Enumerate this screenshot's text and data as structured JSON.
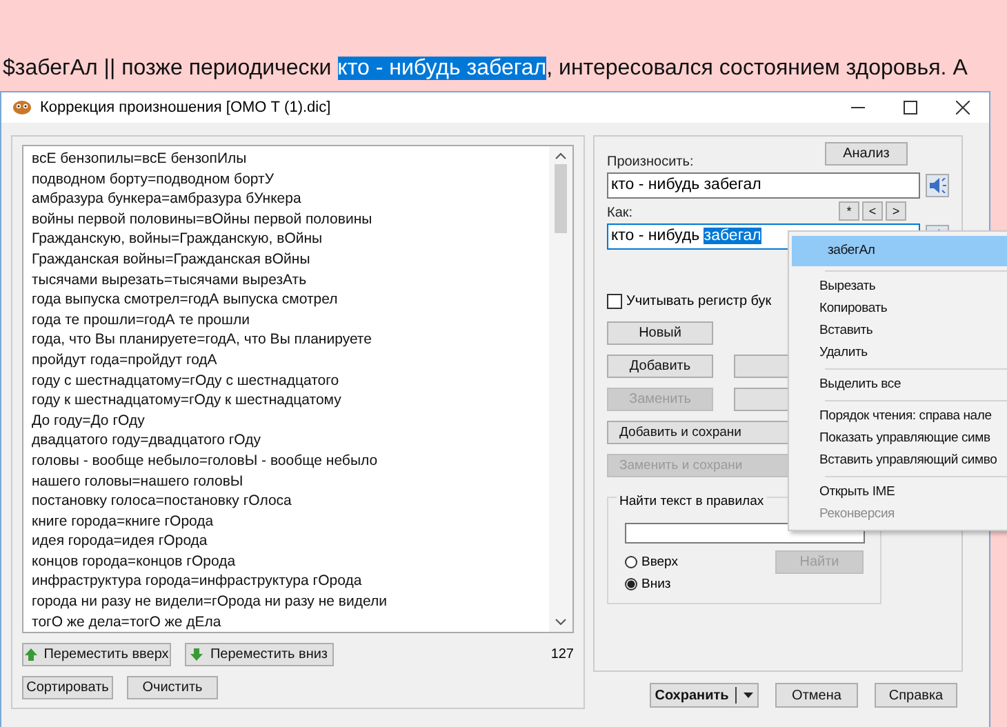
{
  "page_text": [
    {
      "text": "$забегАл || позже периодически ",
      "selected": false
    },
    {
      "text": "кто - нибудь забегал",
      "selected": true
    },
    {
      "text": ", интересовался состоянием здоровья. А",
      "selected": false
    }
  ],
  "window": {
    "title": "Коррекция произношения [ОМО Т (1).dic]"
  },
  "rules": [
    "всЕ бензопилы=всЕ бензопИлы",
    "подводном борту=подводном бортУ",
    "амбразура бункера=амбразура бУнкера",
    "войны первой половины=вОйны первой половины",
    "Гражданскую, войны=Гражданскую, вОйны",
    "Гражданская войны=Гражданская вОйны",
    "тысячами вырезать=тысячами вырезАть",
    "года выпуска смотрел=годА выпуска смотрел",
    "года те прошли=годА те прошли",
    "года, что Вы планируете=годА, что Вы планируете",
    "пройдут года=пройдут годА",
    "году с шестнадцатому=гОду с шестнадцатого",
    "году к шестнадцатому=гОду к шестнадцатому",
    "До году=До гОду",
    "двадцатого году=двадцатого гОду",
    "головы - вообще небыло=головЫ - вообще небыло",
    "нашего головы=нашего головЫ",
    "постановку голоса=постановку гОлоса",
    "книге города=книге гОрода",
    "идея города=идея гОрода",
    "концов города=концов гОрода",
    "инфраструктура города=инфраструктура гОрода",
    "города ни разу не видели=гОрода ни разу не видели",
    "тогО же дела=тогО же дЕла"
  ],
  "move_buttons": [
    {
      "label": "Переместить вверх",
      "kind": "up"
    },
    {
      "label": "Переместить вниз",
      "kind": "down"
    }
  ],
  "count": "127",
  "list_buttons": [
    "Сортировать",
    "Очистить"
  ],
  "analyze_button": "Анализ",
  "pronounce": {
    "label": "Произносить:",
    "value": "кто - нибудь забегал"
  },
  "as": {
    "label": "Как:",
    "value": "кто - нибудь ",
    "selection": "забегал"
  },
  "nav_buttons": [
    "*",
    "<",
    ">"
  ],
  "case_checkbox": {
    "label": "Учитывать регистр бук",
    "checked": false
  },
  "actions": [
    {
      "label": "Новый",
      "kind": "single",
      "disabled": false
    },
    {
      "label": "Добавить",
      "kind": "pair",
      "disabled": false
    },
    {
      "label": "Заменить",
      "kind": "pair",
      "disabled": true
    },
    {
      "label": "Добавить и сохрани",
      "kind": "wide",
      "disabled": false
    },
    {
      "label": "Заменить и сохрани",
      "kind": "wide",
      "disabled": true
    }
  ],
  "find": {
    "title": "Найти текст в правилах",
    "directions": [
      {
        "label": "Вверх",
        "selected": false
      },
      {
        "label": "Вниз",
        "selected": true
      }
    ],
    "button": {
      "label": "Найти",
      "disabled": true
    }
  },
  "footer": [
    {
      "label": "Сохранить",
      "kind": "split"
    },
    {
      "label": "Отмена",
      "kind": "plain"
    },
    {
      "label": "Справка",
      "kind": "plain"
    }
  ],
  "menu": [
    {
      "kind": "item",
      "label": "забегАл",
      "selected": true,
      "disabled": false
    },
    {
      "kind": "separator"
    },
    {
      "kind": "item",
      "label": "Вырезать",
      "selected": false,
      "disabled": false
    },
    {
      "kind": "item",
      "label": "Копировать",
      "selected": false,
      "disabled": false
    },
    {
      "kind": "item",
      "label": "Вставить",
      "selected": false,
      "disabled": false
    },
    {
      "kind": "item",
      "label": "Удалить",
      "selected": false,
      "disabled": false
    },
    {
      "kind": "separator"
    },
    {
      "kind": "item",
      "label": "Выделить все",
      "selected": false,
      "disabled": false
    },
    {
      "kind": "separator"
    },
    {
      "kind": "item",
      "label": "Порядок чтения: справа нале",
      "selected": false,
      "disabled": false
    },
    {
      "kind": "item",
      "label": "Показать управляющие симв",
      "selected": false,
      "disabled": false
    },
    {
      "kind": "item",
      "label": "Вставить управляющий симво",
      "selected": false,
      "disabled": false
    },
    {
      "kind": "separator"
    },
    {
      "kind": "item",
      "label": "Открыть IME",
      "selected": false,
      "disabled": false
    },
    {
      "kind": "item",
      "label": "Реконверсия",
      "selected": false,
      "disabled": true
    }
  ]
}
